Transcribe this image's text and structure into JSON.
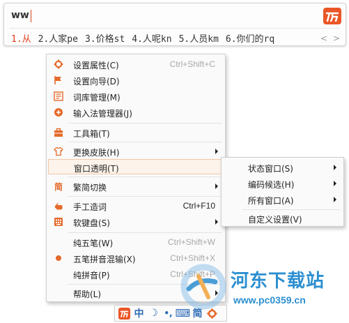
{
  "ime": {
    "input": "ww",
    "candidates": [
      "1.从",
      "2.人家pe",
      "3.价格st",
      "4.人呢kn",
      "5.人员km",
      "6.你们的rq"
    ],
    "prev_page": "<",
    "next_page": ">"
  },
  "main_menu": {
    "items": [
      {
        "label": "设置属性(C)",
        "shortcut": "Ctrl+Shift+C",
        "icon": "gear-icon"
      },
      {
        "label": "设置向导(D)",
        "icon": "flag-icon"
      },
      {
        "label": "词库管理(M)",
        "icon": "dictionary-icon"
      },
      {
        "label": "输入法管理器(J)",
        "icon": "ime-manager-icon"
      },
      {
        "label": "工具箱(T)",
        "icon": "toolbox-icon"
      },
      {
        "label": "更换皮肤(H)",
        "icon": "shirt-icon"
      },
      {
        "label": "窗口透明(T)"
      },
      {
        "label": "繁简切换",
        "icon": "traditional-simplified-icon"
      },
      {
        "label": "手工造词",
        "shortcut": "Ctrl+F10",
        "icon": "hand-icon"
      },
      {
        "label": "软键盘(S)",
        "icon": "soft-keyboard-icon"
      },
      {
        "label": "纯五笔(W)",
        "shortcut": "Ctrl+Shift+W"
      },
      {
        "label": "五笔拼音混输(X)",
        "shortcut": "Ctrl+Shift+X"
      },
      {
        "label": "纯拼音(P)",
        "shortcut": "Ctrl+Shift+P"
      },
      {
        "label": "帮助(L)"
      }
    ]
  },
  "sub_menu": {
    "items": [
      {
        "label": "状态窗口(S)"
      },
      {
        "label": "编码候选(H)"
      },
      {
        "label": "所有窗口(A)"
      },
      {
        "label": "自定义设置(V)"
      }
    ]
  },
  "status_bar": {
    "zh": "中",
    "moon": "☽",
    "dot": "•,",
    "keyboard": "⌨",
    "jian": "简"
  },
  "watermark": {
    "title": "河东下载站",
    "url": "www.pc0359.cn"
  },
  "colors": {
    "brand_orange": "#ea5626",
    "accent_blue": "#2b6ab5",
    "watermark_blue": "#2c8fd0"
  }
}
